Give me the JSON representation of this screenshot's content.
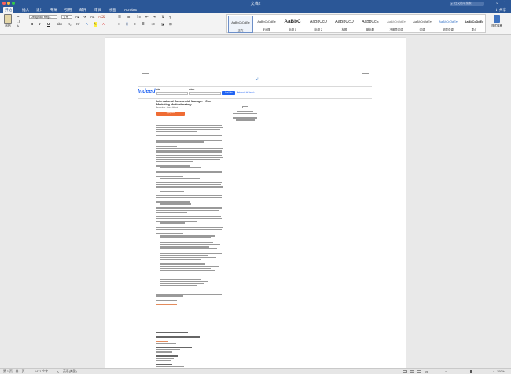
{
  "window": {
    "title": "文档2"
  },
  "search": {
    "placeholder": "在文档中搜索"
  },
  "tabs": [
    "开始",
    "插入",
    "设计",
    "布局",
    "引用",
    "邮件",
    "审阅",
    "视图",
    "Acrobat"
  ],
  "share": "共享",
  "ribbon": {
    "paste": "粘贴",
    "font_name": "DengXian Reg...",
    "font_size": "五号",
    "format_buttons": [
      "B",
      "I",
      "U",
      "abc",
      "X₂",
      "X²"
    ],
    "styles": [
      {
        "sample": "AaBbCcDdEe",
        "name": "正文"
      },
      {
        "sample": "AaBbCcDdEe",
        "name": "无间隔"
      },
      {
        "sample": "AaBbC",
        "name": "标题 1"
      },
      {
        "sample": "AaBbCcD",
        "name": "标题 2"
      },
      {
        "sample": "AaBbCcD",
        "name": "标题"
      },
      {
        "sample": "AaBbCcE",
        "name": "副标题"
      },
      {
        "sample": "AaBbCcDdEe",
        "name": "不明显强调"
      },
      {
        "sample": "AaBbCcDdEe",
        "name": "强调"
      },
      {
        "sample": "AaBbCcDdEe",
        "name": "明显强调"
      },
      {
        "sample": "AaBbCcDdEe",
        "name": "要点"
      }
    ],
    "styles_pane": "样式窗格"
  },
  "document": {
    "logo": "Indeed",
    "search_what": "what",
    "search_where": "where",
    "find_jobs": "Find Jobs",
    "advanced": "Advanced Job Search",
    "job_title": "International Commercial Manager - Core Marketing Multiestlmatory",
    "job_sub": "Amsterdam · Noord-Holland",
    "apply": "Apply Now"
  },
  "status": {
    "page": "第 1 页，共 1 页",
    "words": "1471 个字",
    "lang": "英语(美国)",
    "zoom": "100%"
  }
}
